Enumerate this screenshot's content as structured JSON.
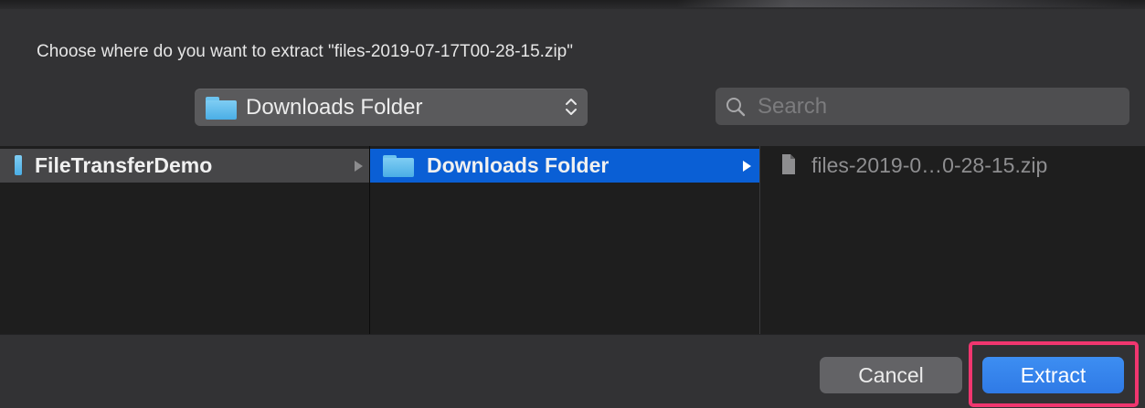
{
  "dialog": {
    "prompt": "Choose where do you want to extract \"files-2019-07-17T00-28-15.zip\""
  },
  "location": {
    "selected": "Downloads Folder",
    "icon": "folder-icon"
  },
  "search": {
    "placeholder": "Search",
    "icon": "search-icon"
  },
  "browser": {
    "columns": [
      {
        "label": "FileTransferDemo",
        "icon": "folder-icon",
        "has_children": true,
        "selected": false
      },
      {
        "label": "Downloads Folder",
        "icon": "folder-icon",
        "has_children": true,
        "selected": true
      },
      {
        "label": "files-2019-0…0-28-15.zip",
        "icon": "document-icon",
        "has_children": false,
        "disabled": true
      }
    ]
  },
  "footer": {
    "cancel_label": "Cancel",
    "extract_label": "Extract"
  },
  "colors": {
    "selection": "#0a5fd5",
    "primary_button": "#3d8ef2",
    "highlight": "#f0366f",
    "folder": "#6cc3ef"
  }
}
